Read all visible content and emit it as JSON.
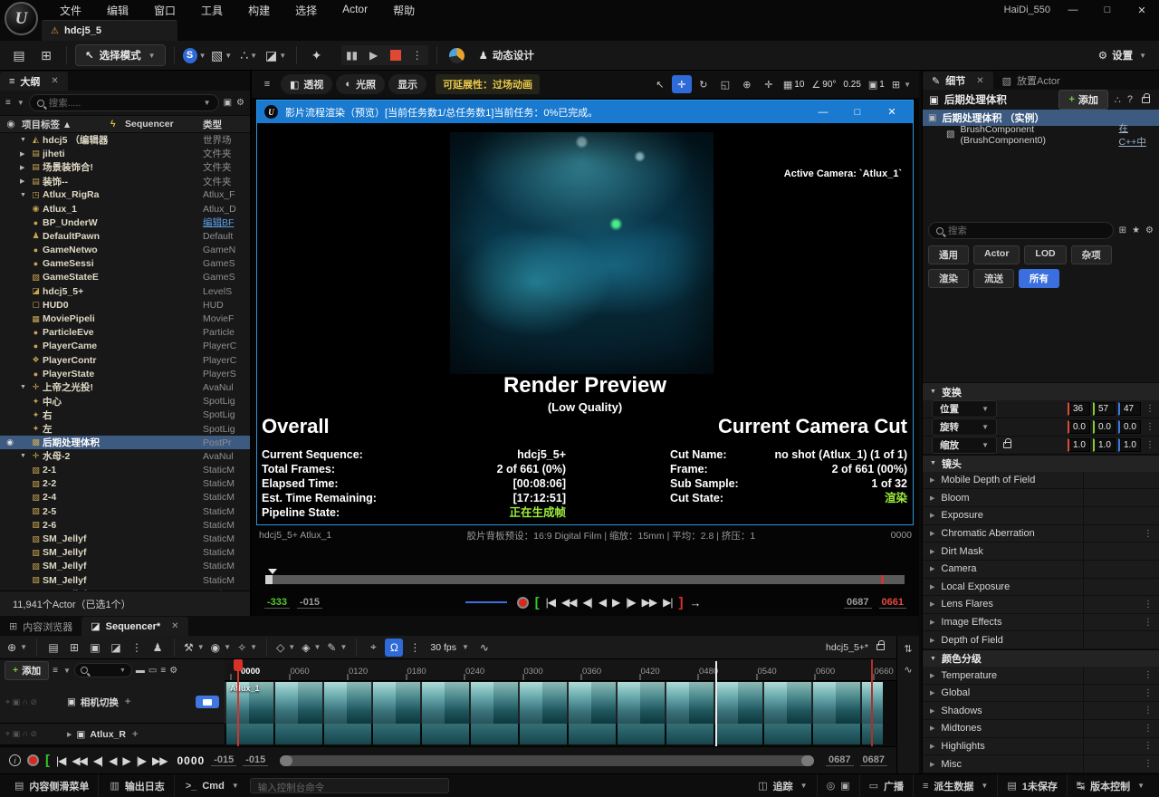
{
  "app": {
    "menu": [
      "文件",
      "编辑",
      "窗口",
      "工具",
      "构建",
      "选择",
      "Actor",
      "帮助"
    ],
    "project": "HaiDi_550",
    "window_buttons": {
      "min": "—",
      "max": "□",
      "close": "✕"
    },
    "doc_tab": "hdcj5_5",
    "toolbar": {
      "select_mode": "选择模式",
      "motion_design": "动态设计",
      "settings": "设置"
    }
  },
  "icons": {
    "ue_logo": "U",
    "warning": "⚠",
    "save": "▤",
    "browse": "⊞",
    "cursor": "↖",
    "blueprint": "S",
    "add_actor": "▧",
    "node": "∴",
    "cinematics": "◪",
    "lamp": "✦",
    "pause": "▮▮",
    "play": "▶",
    "kebab": "⋮",
    "gear": "⚙",
    "star": "★",
    "filter": "≡",
    "folder_add": "▣",
    "eye": "◉",
    "bolt": "ϟ",
    "hamburger": "≡",
    "cube": "◧",
    "lit": "◐",
    "world": "⊕",
    "rotate": "↻",
    "scale": "◱",
    "move": "✛",
    "grid": "▦",
    "angle": "∠",
    "cam": "▣",
    "layout": "⊞",
    "magnet": "Ω",
    "pin": "⌖",
    "curve": "∿",
    "wrench": "⚒",
    "eye2": "◉",
    "wand": "✧",
    "key1": "◇",
    "key2": "◈",
    "pen": "✎",
    "sliders": "⇅",
    "info": "i",
    "clapper": "◪",
    "person": "♟",
    "cmd": ">_",
    "tv": "▭",
    "track": "◫",
    "data": "≡",
    "unsaved": "▤",
    "vcs": "↹",
    "radio": "◎",
    "cambox": "▣",
    "drawer": "▤",
    "log": "▥",
    "lockopen": "",
    "question": "?"
  },
  "outliner": {
    "tab": "大纲",
    "search_placeholder": "搜索.....",
    "columns": {
      "label": "项目标签 ▲",
      "sequencer": "Sequencer",
      "type": "类型"
    },
    "rows": [
      {
        "l": "l0",
        "a": "▼",
        "i": "◭",
        "label": "hdcj5 （编辑器",
        "type": "世界场"
      },
      {
        "l": "l1",
        "a": "▶",
        "i": "▤",
        "label": "jiheti",
        "type": "文件夹"
      },
      {
        "l": "l1",
        "a": "▶",
        "i": "▤",
        "label": "场景装饰合!",
        "type": "文件夹"
      },
      {
        "l": "l1",
        "a": "▶",
        "i": "▤",
        "label": "装饰--",
        "type": "文件夹"
      },
      {
        "l": "l1",
        "a": "▼",
        "i": "◳",
        "label": "Atlux_RigRa",
        "type": "Atlux_F"
      },
      {
        "l": "l2",
        "i": "◉",
        "label": "Atlux_1",
        "type": "Atlux_D"
      },
      {
        "l": "l1",
        "i": "●",
        "label": "BP_UnderW",
        "type": "编辑BF",
        "tcls": "link"
      },
      {
        "l": "l1",
        "i": "♟",
        "label": "DefaultPawn",
        "type": "Default"
      },
      {
        "l": "l1",
        "i": "●",
        "label": "GameNetwo",
        "type": "GameN"
      },
      {
        "l": "l1",
        "i": "●",
        "label": "GameSessi",
        "type": "GameS"
      },
      {
        "l": "l1",
        "i": "▨",
        "label": "GameStateE",
        "type": "GameS"
      },
      {
        "l": "l1",
        "i": "◪",
        "label": "hdcj5_5+",
        "type": "LevelS"
      },
      {
        "l": "l1",
        "i": "▢",
        "label": "HUD0",
        "type": "HUD"
      },
      {
        "l": "l1",
        "i": "▦",
        "label": "MoviePipeli",
        "type": "MovieF"
      },
      {
        "l": "l1",
        "i": "●",
        "label": "ParticleEve",
        "type": "Particle"
      },
      {
        "l": "l1",
        "i": "●",
        "label": "PlayerCame",
        "type": "PlayerC"
      },
      {
        "l": "l1",
        "i": "❖",
        "label": "PlayerContr",
        "type": "PlayerC"
      },
      {
        "l": "l1",
        "i": "●",
        "label": "PlayerState",
        "type": "PlayerS"
      },
      {
        "l": "l1",
        "a": "▼",
        "i": "✛",
        "label": "上帝之光投!",
        "type": "AvaNul"
      },
      {
        "l": "l2",
        "i": "✦",
        "label": "中心",
        "type": "SpotLig"
      },
      {
        "l": "l2",
        "i": "✦",
        "label": "右",
        "type": "SpotLig"
      },
      {
        "l": "l2",
        "i": "✦",
        "label": "左",
        "type": "SpotLig"
      },
      {
        "l": "l1",
        "i": "▩",
        "label": "后期处理体积",
        "type": "PostPr",
        "cls": "sel",
        "eye": "◉"
      },
      {
        "l": "l1",
        "a": "▼",
        "i": "✛",
        "label": "水母-2",
        "type": "AvaNul"
      },
      {
        "l": "l2",
        "i": "▧",
        "label": "2-1",
        "type": "StaticM"
      },
      {
        "l": "l2",
        "i": "▧",
        "label": "2-2",
        "type": "StaticM"
      },
      {
        "l": "l2",
        "i": "▧",
        "label": "2-4",
        "type": "StaticM"
      },
      {
        "l": "l2",
        "i": "▧",
        "label": "2-5",
        "type": "StaticM"
      },
      {
        "l": "l2",
        "i": "▧",
        "label": "2-6",
        "type": "StaticM"
      },
      {
        "l": "l2",
        "i": "▧",
        "label": "SM_Jellyf",
        "type": "StaticM"
      },
      {
        "l": "l2",
        "i": "▧",
        "label": "SM_Jellyf",
        "type": "StaticM"
      },
      {
        "l": "l2",
        "i": "▧",
        "label": "SM_Jellyf",
        "type": "StaticM"
      },
      {
        "l": "l2",
        "i": "▧",
        "label": "SM_Jellyf",
        "type": "StaticM"
      },
      {
        "l": "l2",
        "i": "▧",
        "label": "SM_Jellyf",
        "type": "StaticM"
      }
    ],
    "footer": "11,941个Actor（已选1个）"
  },
  "viewport": {
    "perspective": "透视",
    "lit": "光照",
    "show": "显示",
    "badge": "可延展性：过场动画",
    "grid": "10",
    "angle": "90°",
    "snap": "0.25",
    "cam_speed": "1"
  },
  "render_window": {
    "title": "影片流程渲染（预览）[当前任务数1/总任务数1]当前任务：0%已完成。",
    "active_camera": "Active Camera: `Atlux_1`",
    "preview_title": "Render Preview",
    "preview_subtitle": "(Low Quality)",
    "overall": {
      "heading": "Overall",
      "rows": [
        {
          "k": "Current Sequence:",
          "v": "hdcj5_5+"
        },
        {
          "k": "Total Frames:",
          "v": "2 of 661 (0%)"
        },
        {
          "k": "Elapsed Time:",
          "v": "[00:08:06]"
        },
        {
          "k": "Est. Time Remaining:",
          "v": "[17:12:51]"
        },
        {
          "k": "Pipeline State:",
          "v": "正在生成帧",
          "c": "#9ded3c"
        }
      ]
    },
    "camera_cut": {
      "heading": "Current Camera Cut",
      "rows": [
        {
          "k": "Cut Name:",
          "v": "no shot (Atlux_1) (1 of 1)"
        },
        {
          "k": "Frame:",
          "v": "2 of 661 (00%)"
        },
        {
          "k": "Sub Sample:",
          "v": "1 of 32"
        },
        {
          "k": "Cut State:",
          "v": "渲染",
          "c": "#9ded3c"
        }
      ]
    }
  },
  "cine_bar": {
    "left": "hdcj5_5+ Atlux_1",
    "center": "胶片背板预设：16:9 Digital Film | 缩放：15mm | 平均：2.8 | 挤压：1",
    "right": "0000",
    "start": "-333",
    "preroll": "-015",
    "out": "0687",
    "end": "0661",
    "buttons": [
      {
        "g": "|◀"
      },
      {
        "g": "◀◀"
      },
      {
        "g": "◀|"
      },
      {
        "g": "◀"
      },
      {
        "g": "▶"
      },
      {
        "g": "|▶"
      },
      {
        "g": "▶▶"
      },
      {
        "g": "▶|"
      }
    ],
    "loop_in": "[",
    "loop_out": "]",
    "arrow": "→"
  },
  "details": {
    "tab": "细节",
    "tab2": "放置Actor",
    "title": "后期处理体积",
    "add": "添加",
    "comp_root": "后期处理体积 （实例）",
    "comp_child": "BrushComponent (BrushComponent0)",
    "comp_link": "在C++中",
    "search_placeholder": "搜索",
    "chips": [
      {
        "label": "通用"
      },
      {
        "label": "Actor"
      },
      {
        "label": "LOD"
      },
      {
        "label": "杂项"
      },
      {
        "label": "渲染"
      },
      {
        "label": "流送"
      },
      {
        "label": "所有",
        "cls": "on"
      }
    ],
    "transform_heading": "变换",
    "transform": [
      {
        "name": "位置",
        "x": "36",
        "y": "57",
        "z": "47"
      },
      {
        "name": "旋转",
        "x": "0.0",
        "y": "0.0",
        "z": "0.0"
      },
      {
        "name": "缩放",
        "x": "1.0",
        "y": "1.0",
        "z": "1.0",
        "lock": true
      }
    ],
    "lens_heading": "镜头",
    "lens_sections": [
      {
        "label": "Mobile Depth of Field"
      },
      {
        "label": "Bloom"
      },
      {
        "label": "Exposure"
      },
      {
        "label": "Chromatic Aberration",
        "menu": "⋮"
      },
      {
        "label": "Dirt Mask"
      },
      {
        "label": "Camera"
      },
      {
        "label": "Local Exposure"
      },
      {
        "label": "Lens Flares",
        "menu": "⋮"
      },
      {
        "label": "Image Effects",
        "menu": "⋮"
      },
      {
        "label": "Depth of Field"
      }
    ],
    "color_heading": "颜色分级",
    "color_sections": [
      {
        "label": "Temperature",
        "menu": "⋮"
      },
      {
        "label": "Global",
        "menu": "⋮"
      },
      {
        "label": "Shadows",
        "menu": "⋮"
      },
      {
        "label": "Midtones",
        "menu": "⋮"
      },
      {
        "label": "Highlights",
        "menu": "⋮"
      },
      {
        "label": "Misc",
        "menu": "⋮"
      }
    ]
  },
  "sequencer": {
    "tab_browser": "内容浏览器",
    "tab_sequencer": "Sequencer*",
    "fps": "30 fps",
    "sequence_name": "hdcj5_5+*",
    "add": "添加",
    "ruler": [
      {
        "label": "0000",
        "cls": "t0"
      },
      {
        "label": "0060"
      },
      {
        "label": "0120"
      },
      {
        "label": "0180"
      },
      {
        "label": "0240"
      },
      {
        "label": "0300"
      },
      {
        "label": "0360"
      },
      {
        "label": "0420"
      },
      {
        "label": "0480"
      },
      {
        "label": "0540"
      },
      {
        "label": "0600"
      },
      {
        "label": "0660"
      }
    ],
    "track1": "相机切换",
    "track2": "Atlux_R",
    "clip_label": "Atlux_1",
    "frame": "0000",
    "in1": "-015",
    "in2": "-015",
    "out1": "0687",
    "out2": "0687",
    "buttons": [
      {
        "g": "|◀"
      },
      {
        "g": "◀◀"
      },
      {
        "g": "◀|"
      },
      {
        "g": "◀"
      },
      {
        "g": "▶"
      },
      {
        "g": "|▶"
      },
      {
        "g": "▶▶"
      }
    ],
    "loop_in": "["
  },
  "statusbar": {
    "drawer": "内容侧滑菜单",
    "log": "输出日志",
    "cmd": "Cmd",
    "console_placeholder": "输入控制台命令",
    "trace": "追踪",
    "broadcast": "广播",
    "derived": "派生数据",
    "unsaved": "1未保存",
    "vcs": "版本控制"
  }
}
